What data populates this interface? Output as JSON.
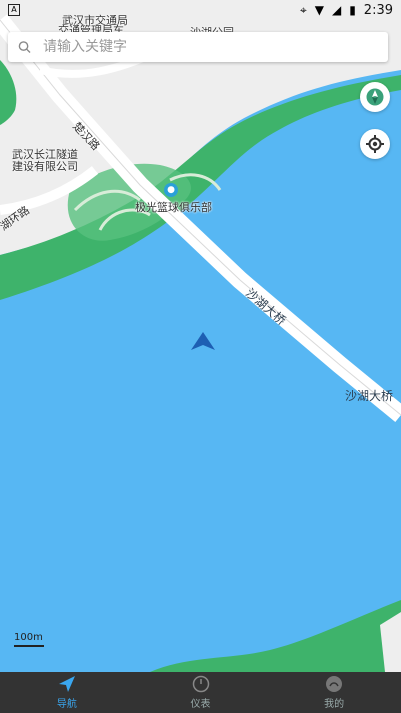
{
  "status_bar": {
    "time": "2:39"
  },
  "search": {
    "placeholder": "请输入关键字"
  },
  "map": {
    "labels": {
      "top_partial_1": "武汉市交通局",
      "top_partial_2": "交通管理局车",
      "company_1": "武汉长江隧道",
      "company_2": "建设有限公司",
      "road_chuhan": "楚汉路",
      "road_ring": "湖环路",
      "poi_basketball": "极光篮球俱乐部",
      "bridge_label_diag": "沙湖大桥",
      "bridge_label_right": "沙湖大桥",
      "top_partial_3": "沙湖公园"
    },
    "scale": "100m"
  },
  "tabs": [
    {
      "label": "导航",
      "icon": "navigate-icon",
      "active": true
    },
    {
      "label": "仪表",
      "icon": "gauge-icon",
      "active": false
    },
    {
      "label": "我的",
      "icon": "profile-icon",
      "active": false
    }
  ],
  "colors": {
    "water": "#57b7f3",
    "park": "#3eb36b",
    "land": "#eaeaea",
    "tab_active": "#3aa7f0"
  }
}
